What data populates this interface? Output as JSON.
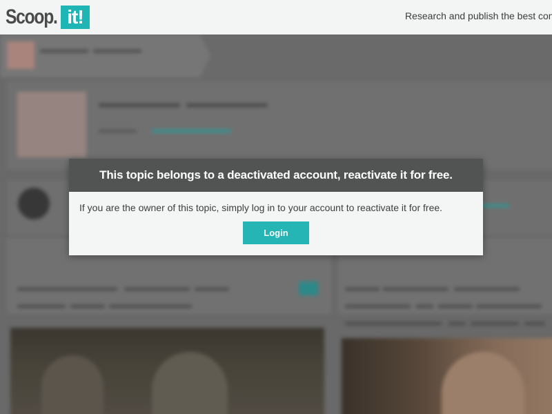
{
  "header": {
    "logo_text": "Scoop.",
    "logo_badge": "it!",
    "tagline": "Research and publish the best content."
  },
  "modal": {
    "title": "This topic belongs to a deactivated account, reactivate it for free.",
    "message": "If you are the owner of this topic, simply log in to your account to reactivate it for free.",
    "login_label": "Login"
  },
  "colors": {
    "accent": "#26b5b5",
    "modal_header_bg": "#525454",
    "modal_body_bg": "#f4f5f5",
    "topbar_bg": "#f3f4f4"
  }
}
